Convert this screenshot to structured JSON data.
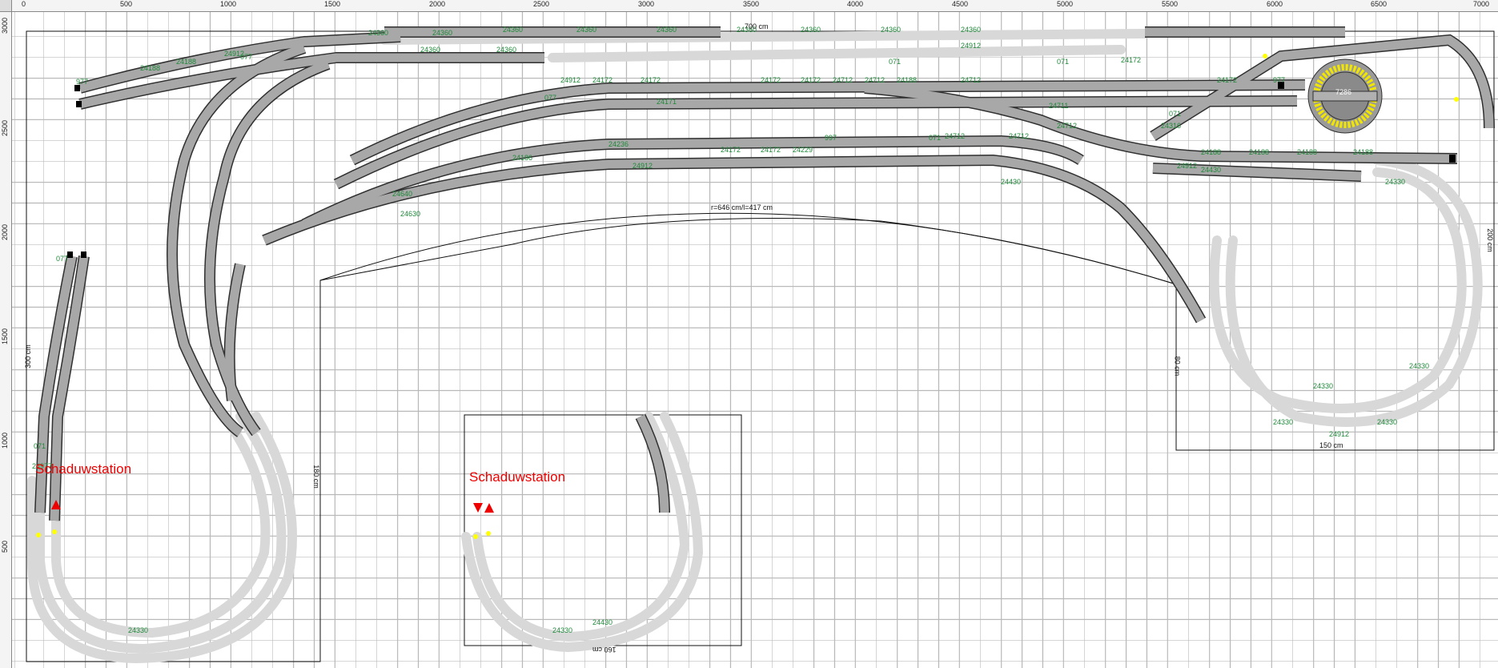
{
  "ruler": {
    "top_ticks": [
      "0",
      "500",
      "1000",
      "1500",
      "2000",
      "2500",
      "3000",
      "3500",
      "4000",
      "4500",
      "5000",
      "5500",
      "6000",
      "6500",
      "7000"
    ],
    "left_ticks": [
      "3000",
      "2500",
      "2000",
      "1500",
      "1000",
      "500"
    ]
  },
  "dimensions": {
    "top_width": "700 cm",
    "arc_label": "r=646 cm/l=417 cm",
    "left_height": "300 cm",
    "left_inner": "180 cm",
    "right_height": "200 cm",
    "right_inner": "80 cm",
    "right_bottom": "150 cm",
    "inset_bottom": "160 cm"
  },
  "labels": {
    "shadow_station_1": "Schaduwstation",
    "shadow_station_2": "Schaduwstation",
    "turntable": "7286"
  },
  "colors": {
    "track": "#a8a8a8",
    "track_edge": "#303030",
    "hidden_track": "#d8d8d8",
    "label_green": "#1f8a3a",
    "station_red": "#e00000",
    "turntable_yellow": "#f2e600",
    "outline": "#111111"
  },
  "track_numbers": [
    "24360",
    "24360",
    "24360",
    "24360",
    "24360",
    "24360",
    "24360",
    "24360",
    "24360",
    "24360",
    "24360",
    "24172",
    "24172",
    "24172",
    "24172",
    "24172",
    "24172",
    "24172",
    "24172",
    "24188",
    "24188",
    "24188",
    "24188",
    "24188",
    "24188",
    "24188",
    "24712",
    "24712",
    "24712",
    "24712",
    "24712",
    "24712",
    "24912",
    "24912",
    "24912",
    "24912",
    "24912",
    "24912",
    "24330",
    "24330",
    "24330",
    "24330",
    "24330",
    "24330",
    "24330",
    "24430",
    "24430",
    "24430",
    "24316",
    "24236",
    "24229",
    "24186",
    "24711",
    "24171",
    "24630",
    "24640",
    "071",
    "071",
    "071",
    "071",
    "071",
    "077",
    "077",
    "077",
    "977",
    "977",
    "997",
    "24977"
  ]
}
